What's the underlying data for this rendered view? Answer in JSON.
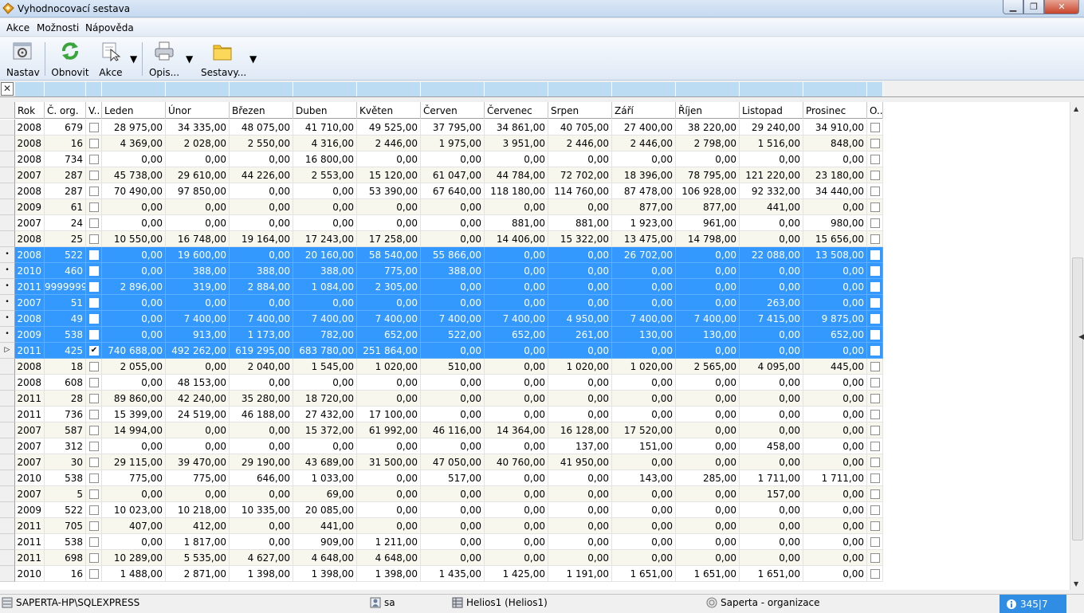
{
  "window": {
    "title": "Vyhodnocovací sestava"
  },
  "menu": [
    "Akce",
    "Možnosti",
    "Nápověda"
  ],
  "toolbar": {
    "nastav": "Nastav",
    "obnovit": "Obnovit",
    "akce": "Akce",
    "opis": "Opis...",
    "sestavy": "Sestavy..."
  },
  "colors": {
    "selection": "#3399ff",
    "filter": "#bcdcf4",
    "alt_row": "#f7f7ee",
    "status_active": "#2f8de4"
  },
  "icons": [
    "settings-icon",
    "refresh-icon",
    "action-cursor-icon",
    "printer-icon",
    "folder-icon",
    "server-icon",
    "user-icon",
    "database-icon",
    "organization-icon",
    "info-icon"
  ],
  "grid": {
    "columns": [
      "Rok",
      "Č. org.",
      "V..",
      "Leden",
      "Únor",
      "Březen",
      "Duben",
      "Květen",
      "Červen",
      "Červenec",
      "Srpen",
      "Září",
      "Říjen",
      "Listopad",
      "Prosinec",
      "O.."
    ],
    "rows": [
      {
        "sel": false,
        "mark": "",
        "v": "",
        "cells": [
          "2008",
          "679",
          "28 975,00",
          "34 335,00",
          "48 075,00",
          "41 710,00",
          "49 525,00",
          "37 795,00",
          "34 861,00",
          "40 705,00",
          "27 400,00",
          "38 220,00",
          "29 240,00",
          "34 910,00"
        ]
      },
      {
        "sel": false,
        "mark": "",
        "v": "",
        "cells": [
          "2008",
          "16",
          "4 369,00",
          "2 028,00",
          "2 550,00",
          "4 316,00",
          "2 446,00",
          "1 975,00",
          "3 951,00",
          "2 446,00",
          "2 446,00",
          "2 798,00",
          "1 516,00",
          "848,00"
        ]
      },
      {
        "sel": false,
        "mark": "",
        "v": "",
        "cells": [
          "2008",
          "734",
          "0,00",
          "0,00",
          "0,00",
          "16 800,00",
          "0,00",
          "0,00",
          "0,00",
          "0,00",
          "0,00",
          "0,00",
          "0,00",
          "0,00"
        ]
      },
      {
        "sel": false,
        "mark": "",
        "v": "",
        "cells": [
          "2007",
          "287",
          "45 738,00",
          "29 610,00",
          "44 226,00",
          "2 553,00",
          "15 120,00",
          "61 047,00",
          "44 784,00",
          "72 702,00",
          "18 396,00",
          "78 795,00",
          "121 220,00",
          "23 180,00"
        ]
      },
      {
        "sel": false,
        "mark": "",
        "v": "",
        "cells": [
          "2008",
          "287",
          "70 490,00",
          "97 850,00",
          "0,00",
          "0,00",
          "53 390,00",
          "67 640,00",
          "118 180,00",
          "114 760,00",
          "87 478,00",
          "106 928,00",
          "92 332,00",
          "34 440,00"
        ]
      },
      {
        "sel": false,
        "mark": "",
        "v": "",
        "cells": [
          "2009",
          "61",
          "0,00",
          "0,00",
          "0,00",
          "0,00",
          "0,00",
          "0,00",
          "0,00",
          "0,00",
          "877,00",
          "877,00",
          "441,00",
          "0,00"
        ]
      },
      {
        "sel": false,
        "mark": "",
        "v": "",
        "cells": [
          "2007",
          "24",
          "0,00",
          "0,00",
          "0,00",
          "0,00",
          "0,00",
          "0,00",
          "881,00",
          "881,00",
          "1 923,00",
          "961,00",
          "0,00",
          "980,00"
        ]
      },
      {
        "sel": false,
        "mark": "",
        "v": "",
        "cells": [
          "2008",
          "25",
          "10 550,00",
          "16 748,00",
          "19 164,00",
          "17 243,00",
          "17 258,00",
          "0,00",
          "14 406,00",
          "15 322,00",
          "13 475,00",
          "14 798,00",
          "0,00",
          "15 656,00"
        ]
      },
      {
        "sel": true,
        "mark": "•",
        "v": "",
        "cells": [
          "2008",
          "522",
          "0,00",
          "19 600,00",
          "0,00",
          "20 160,00",
          "58 540,00",
          "55 866,00",
          "0,00",
          "0,00",
          "26 702,00",
          "0,00",
          "22 088,00",
          "13 508,00"
        ]
      },
      {
        "sel": true,
        "mark": "•",
        "v": "",
        "cells": [
          "2010",
          "460",
          "0,00",
          "388,00",
          "388,00",
          "388,00",
          "775,00",
          "388,00",
          "0,00",
          "0,00",
          "0,00",
          "0,00",
          "0,00",
          "0,00"
        ]
      },
      {
        "sel": true,
        "mark": "•",
        "v": "",
        "cells": [
          "2011",
          "9999999",
          "2 896,00",
          "319,00",
          "2 884,00",
          "1 084,00",
          "2 305,00",
          "0,00",
          "0,00",
          "0,00",
          "0,00",
          "0,00",
          "0,00",
          "0,00"
        ]
      },
      {
        "sel": true,
        "mark": "•",
        "v": "",
        "cells": [
          "2007",
          "51",
          "0,00",
          "0,00",
          "0,00",
          "0,00",
          "0,00",
          "0,00",
          "0,00",
          "0,00",
          "0,00",
          "0,00",
          "263,00",
          "0,00"
        ]
      },
      {
        "sel": true,
        "mark": "•",
        "v": "",
        "cells": [
          "2008",
          "49",
          "0,00",
          "7 400,00",
          "7 400,00",
          "7 400,00",
          "7 400,00",
          "7 400,00",
          "7 400,00",
          "4 950,00",
          "7 400,00",
          "7 400,00",
          "7 415,00",
          "9 875,00"
        ]
      },
      {
        "sel": true,
        "mark": "•",
        "v": "",
        "cells": [
          "2009",
          "538",
          "0,00",
          "913,00",
          "1 173,00",
          "782,00",
          "652,00",
          "522,00",
          "652,00",
          "261,00",
          "130,00",
          "130,00",
          "0,00",
          "652,00"
        ]
      },
      {
        "sel": true,
        "mark": "▷",
        "v": "✔",
        "cells": [
          "2011",
          "425",
          "740 688,00",
          "492 262,00",
          "619 295,00",
          "683 780,00",
          "251 864,00",
          "0,00",
          "0,00",
          "0,00",
          "0,00",
          "0,00",
          "0,00",
          "0,00"
        ]
      },
      {
        "sel": false,
        "mark": "",
        "v": "",
        "cells": [
          "2008",
          "18",
          "2 055,00",
          "0,00",
          "2 040,00",
          "1 545,00",
          "1 020,00",
          "510,00",
          "0,00",
          "1 020,00",
          "1 020,00",
          "2 565,00",
          "4 095,00",
          "445,00"
        ]
      },
      {
        "sel": false,
        "mark": "",
        "v": "",
        "cells": [
          "2008",
          "608",
          "0,00",
          "48 153,00",
          "0,00",
          "0,00",
          "0,00",
          "0,00",
          "0,00",
          "0,00",
          "0,00",
          "0,00",
          "0,00",
          "0,00"
        ]
      },
      {
        "sel": false,
        "mark": "",
        "v": "",
        "cells": [
          "2011",
          "28",
          "89 860,00",
          "42 240,00",
          "35 280,00",
          "18 720,00",
          "0,00",
          "0,00",
          "0,00",
          "0,00",
          "0,00",
          "0,00",
          "0,00",
          "0,00"
        ]
      },
      {
        "sel": false,
        "mark": "",
        "v": "",
        "cells": [
          "2011",
          "736",
          "15 399,00",
          "24 519,00",
          "46 188,00",
          "27 432,00",
          "17 100,00",
          "0,00",
          "0,00",
          "0,00",
          "0,00",
          "0,00",
          "0,00",
          "0,00"
        ]
      },
      {
        "sel": false,
        "mark": "",
        "v": "",
        "cells": [
          "2007",
          "587",
          "14 994,00",
          "0,00",
          "0,00",
          "15 372,00",
          "61 992,00",
          "46 116,00",
          "14 364,00",
          "16 128,00",
          "17 520,00",
          "0,00",
          "0,00",
          "0,00"
        ]
      },
      {
        "sel": false,
        "mark": "",
        "v": "",
        "cells": [
          "2007",
          "312",
          "0,00",
          "0,00",
          "0,00",
          "0,00",
          "0,00",
          "0,00",
          "0,00",
          "137,00",
          "151,00",
          "0,00",
          "458,00",
          "0,00"
        ]
      },
      {
        "sel": false,
        "mark": "",
        "v": "",
        "cells": [
          "2007",
          "30",
          "29 115,00",
          "39 470,00",
          "29 190,00",
          "43 689,00",
          "31 500,00",
          "47 050,00",
          "40 760,00",
          "41 950,00",
          "0,00",
          "0,00",
          "0,00",
          "0,00"
        ]
      },
      {
        "sel": false,
        "mark": "",
        "v": "",
        "cells": [
          "2010",
          "538",
          "775,00",
          "775,00",
          "646,00",
          "1 033,00",
          "0,00",
          "517,00",
          "0,00",
          "0,00",
          "143,00",
          "285,00",
          "1 711,00",
          "1 711,00"
        ]
      },
      {
        "sel": false,
        "mark": "",
        "v": "",
        "cells": [
          "2007",
          "5",
          "0,00",
          "0,00",
          "0,00",
          "69,00",
          "0,00",
          "0,00",
          "0,00",
          "0,00",
          "0,00",
          "0,00",
          "157,00",
          "0,00"
        ]
      },
      {
        "sel": false,
        "mark": "",
        "v": "",
        "cells": [
          "2009",
          "522",
          "10 023,00",
          "10 218,00",
          "10 335,00",
          "20 085,00",
          "0,00",
          "0,00",
          "0,00",
          "0,00",
          "0,00",
          "0,00",
          "0,00",
          "0,00"
        ]
      },
      {
        "sel": false,
        "mark": "",
        "v": "",
        "cells": [
          "2011",
          "705",
          "407,00",
          "412,00",
          "0,00",
          "441,00",
          "0,00",
          "0,00",
          "0,00",
          "0,00",
          "0,00",
          "0,00",
          "0,00",
          "0,00"
        ]
      },
      {
        "sel": false,
        "mark": "",
        "v": "",
        "cells": [
          "2011",
          "538",
          "0,00",
          "1 817,00",
          "0,00",
          "909,00",
          "1 211,00",
          "0,00",
          "0,00",
          "0,00",
          "0,00",
          "0,00",
          "0,00",
          "0,00"
        ]
      },
      {
        "sel": false,
        "mark": "",
        "v": "",
        "cells": [
          "2011",
          "698",
          "10 289,00",
          "5 535,00",
          "4 627,00",
          "4 648,00",
          "4 648,00",
          "0,00",
          "0,00",
          "0,00",
          "0,00",
          "0,00",
          "0,00",
          "0,00"
        ]
      },
      {
        "sel": false,
        "mark": "",
        "v": "",
        "cells": [
          "2010",
          "16",
          "1 488,00",
          "2 871,00",
          "1 398,00",
          "1 398,00",
          "1 398,00",
          "1 435,00",
          "1 425,00",
          "1 191,00",
          "1 651,00",
          "1 651,00",
          "1 651,00",
          "0,00"
        ]
      }
    ]
  },
  "status": {
    "server": "SAPERTA-HP\\SQLEXPRESS",
    "user": "sa",
    "database": "Helios1 (Helios1)",
    "organization": "Saperta - organizace",
    "count": "345|7"
  }
}
